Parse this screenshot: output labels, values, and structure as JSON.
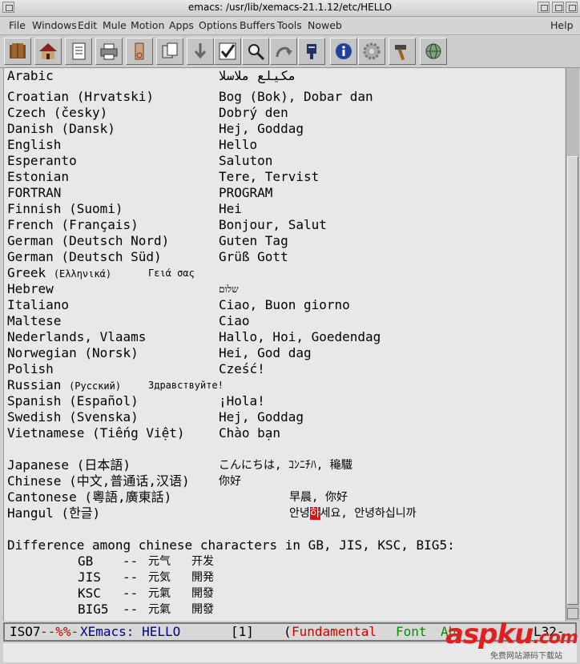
{
  "window": {
    "title": "emacs: /usr/lib/xemacs-21.1.12/etc/HELLO"
  },
  "menubar": {
    "items": [
      "File",
      "Windows",
      "Edit",
      "Mule",
      "Motion",
      "Apps",
      "Options",
      "Buffers",
      "Tools",
      "Noweb"
    ],
    "help": "Help"
  },
  "toolbar": {
    "icons": [
      "open-book-icon",
      "house-icon",
      "document-icon",
      "printer-icon",
      "scissors-icon",
      "copy-icon",
      "paste-down-arrow-icon",
      "checkmark-icon",
      "magnifier-icon",
      "redo-arrow-icon",
      "mailbox-icon",
      "info-icon",
      "gear-icon",
      "hammer-icon",
      "globe-icon"
    ]
  },
  "buffer": {
    "rows": [
      {
        "lang": "Arabic",
        "greet": "مكيلع ملاسلا"
      },
      {
        "lang": "Croatian (Hrvatski)",
        "greet": "Bog (Bok), Dobar dan"
      },
      {
        "lang": "Czech (česky)",
        "greet": "Dobrý den"
      },
      {
        "lang": "Danish (Dansk)",
        "greet": "Hej, Goddag"
      },
      {
        "lang": "English",
        "greet": "Hello"
      },
      {
        "lang": "Esperanto",
        "greet": "Saluton"
      },
      {
        "lang": "Estonian",
        "greet": "Tere, Tervist"
      },
      {
        "lang": "FORTRAN",
        "greet": "PROGRAM"
      },
      {
        "lang": "Finnish (Suomi)",
        "greet": "Hei"
      },
      {
        "lang": "French (Français)",
        "greet": "Bonjour, Salut"
      },
      {
        "lang": "German (Deutsch Nord)",
        "greet": "Guten Tag"
      },
      {
        "lang": "German (Deutsch Süd)",
        "greet": "Grüß Gott"
      },
      {
        "lang": "Greek",
        "lang_native": "(Ελληνικά)",
        "greet": "Γειά σας"
      },
      {
        "lang": "Hebrew",
        "greet": "שלום"
      },
      {
        "lang": "Italiano",
        "greet": "Ciao, Buon giorno"
      },
      {
        "lang": "Maltese",
        "greet": "Ciao"
      },
      {
        "lang": "Nederlands, Vlaams",
        "greet": "Hallo, Hoi, Goedendag"
      },
      {
        "lang": "Norwegian (Norsk)",
        "greet": "Hei, God dag"
      },
      {
        "lang": "Polish",
        "greet": "Cześć!"
      },
      {
        "lang": "Russian",
        "lang_native": "(Русский)",
        "greet": "Здравствуйте!"
      },
      {
        "lang": "Spanish (Español)",
        "greet": "¡Hola!"
      },
      {
        "lang": "Swedish (Svenska)",
        "greet": "Hej, Goddag"
      },
      {
        "lang": "Vietnamese (Tiếng Việt)",
        "greet": "Chào bạn"
      }
    ],
    "cjk_rows": [
      {
        "lang": "Japanese (日本語)",
        "greet": "こんにちは, ｺﾝﾆﾁﾊ, 龝驖"
      },
      {
        "lang": "Chinese (中文,普通话,汉语)",
        "greet": "你好"
      },
      {
        "lang": "Cantonese (粵語,廣東話)",
        "greet": "早晨, 你好"
      },
      {
        "lang": "Hangul (한글)",
        "greet_pre": "안녕",
        "greet_cursor": "하",
        "greet_post": "세요, 안녕하십니까"
      }
    ],
    "difference_heading": "Difference among chinese characters in GB, JIS, KSC, BIG5:",
    "charsets": [
      {
        "name": "GB",
        "sep": "--",
        "a": "元气",
        "b": "开发"
      },
      {
        "name": "JIS",
        "sep": "--",
        "a": "元気",
        "b": "開発"
      },
      {
        "name": "KSC",
        "sep": "--",
        "a": "元氣",
        "b": "開發"
      },
      {
        "name": "BIG5",
        "sep": "--",
        "a": "元氣",
        "b": "開發"
      }
    ]
  },
  "modeline": {
    "coding": "ISO7",
    "status": "--%%-",
    "buffer": "XEmacs: HELLO",
    "window_num": "[1]",
    "open_paren": "(",
    "major_mode": "Fundamental",
    "minor_mode": "Font",
    "minor_mode_2": "Ab",
    "position": "L32-"
  },
  "watermark": {
    "logo": "aspku",
    "logo_suffix": ".com",
    "subtitle": "免费网站源码下载站"
  },
  "colors": {
    "modeline_coding": "#000000",
    "modeline_status": "#c00000",
    "modeline_buffer": "#00008b",
    "major_mode": "#d00000",
    "minor_mode": "#009000",
    "cursor": "#e01010"
  }
}
